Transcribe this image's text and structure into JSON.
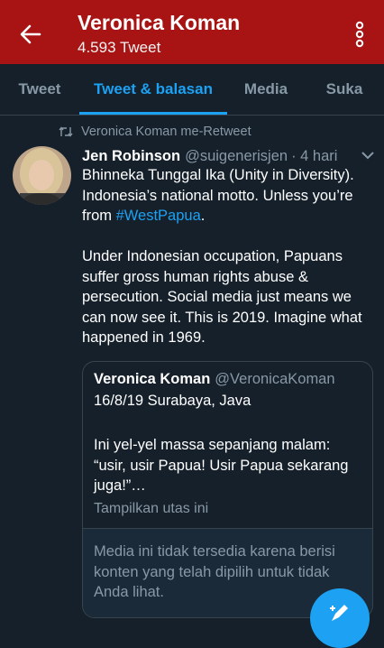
{
  "header": {
    "title": "Veronica Koman",
    "subtitle": "4.593 Tweet",
    "background": "#a81414"
  },
  "tabs": [
    {
      "label": "Tweet",
      "active": false
    },
    {
      "label": "Tweet & balasan",
      "active": true
    },
    {
      "label": "Media",
      "active": false
    },
    {
      "label": "Suka",
      "active": false
    }
  ],
  "tweet": {
    "retweet_context": "Veronica Koman me-Retweet",
    "author_name": "Jen Robinson",
    "author_handle": "@suigenerisjen",
    "time": "· 4 hari",
    "text_p1_a": "Bhinneka Tunggal Ika (Unity in Diversity). Indonesia’s national motto. Unless you’re from ",
    "hashtag": "#WestPapua",
    "text_p1_b": ".",
    "text_p2": "Under Indonesian occupation, Papuans suffer gross human rights abuse & persecution. Social media just means we can now see it. This is 2019. Imagine what happened in 1969."
  },
  "quote": {
    "author_name": "Veronica Koman",
    "author_handle": "@VeronicaKoman",
    "line1": "16/8/19 Surabaya, Java",
    "line2": "Ini yel-yel massa sepanjang malam: “usir, usir Papua! Usir Papua sekarang juga!”…",
    "show_thread": "Tampilkan utas ini",
    "media_notice": "Media ini tidak tersedia karena berisi konten yang telah dipilih untuk tidak Anda lihat."
  },
  "colors": {
    "accent": "#1da1f2",
    "background": "#15202b",
    "muted_text": "#8899a6"
  },
  "icons": {
    "back": "arrow-left-icon",
    "more": "more-vertical-icon",
    "retweet": "retweet-icon",
    "chevron": "chevron-down-icon",
    "compose": "compose-icon"
  }
}
